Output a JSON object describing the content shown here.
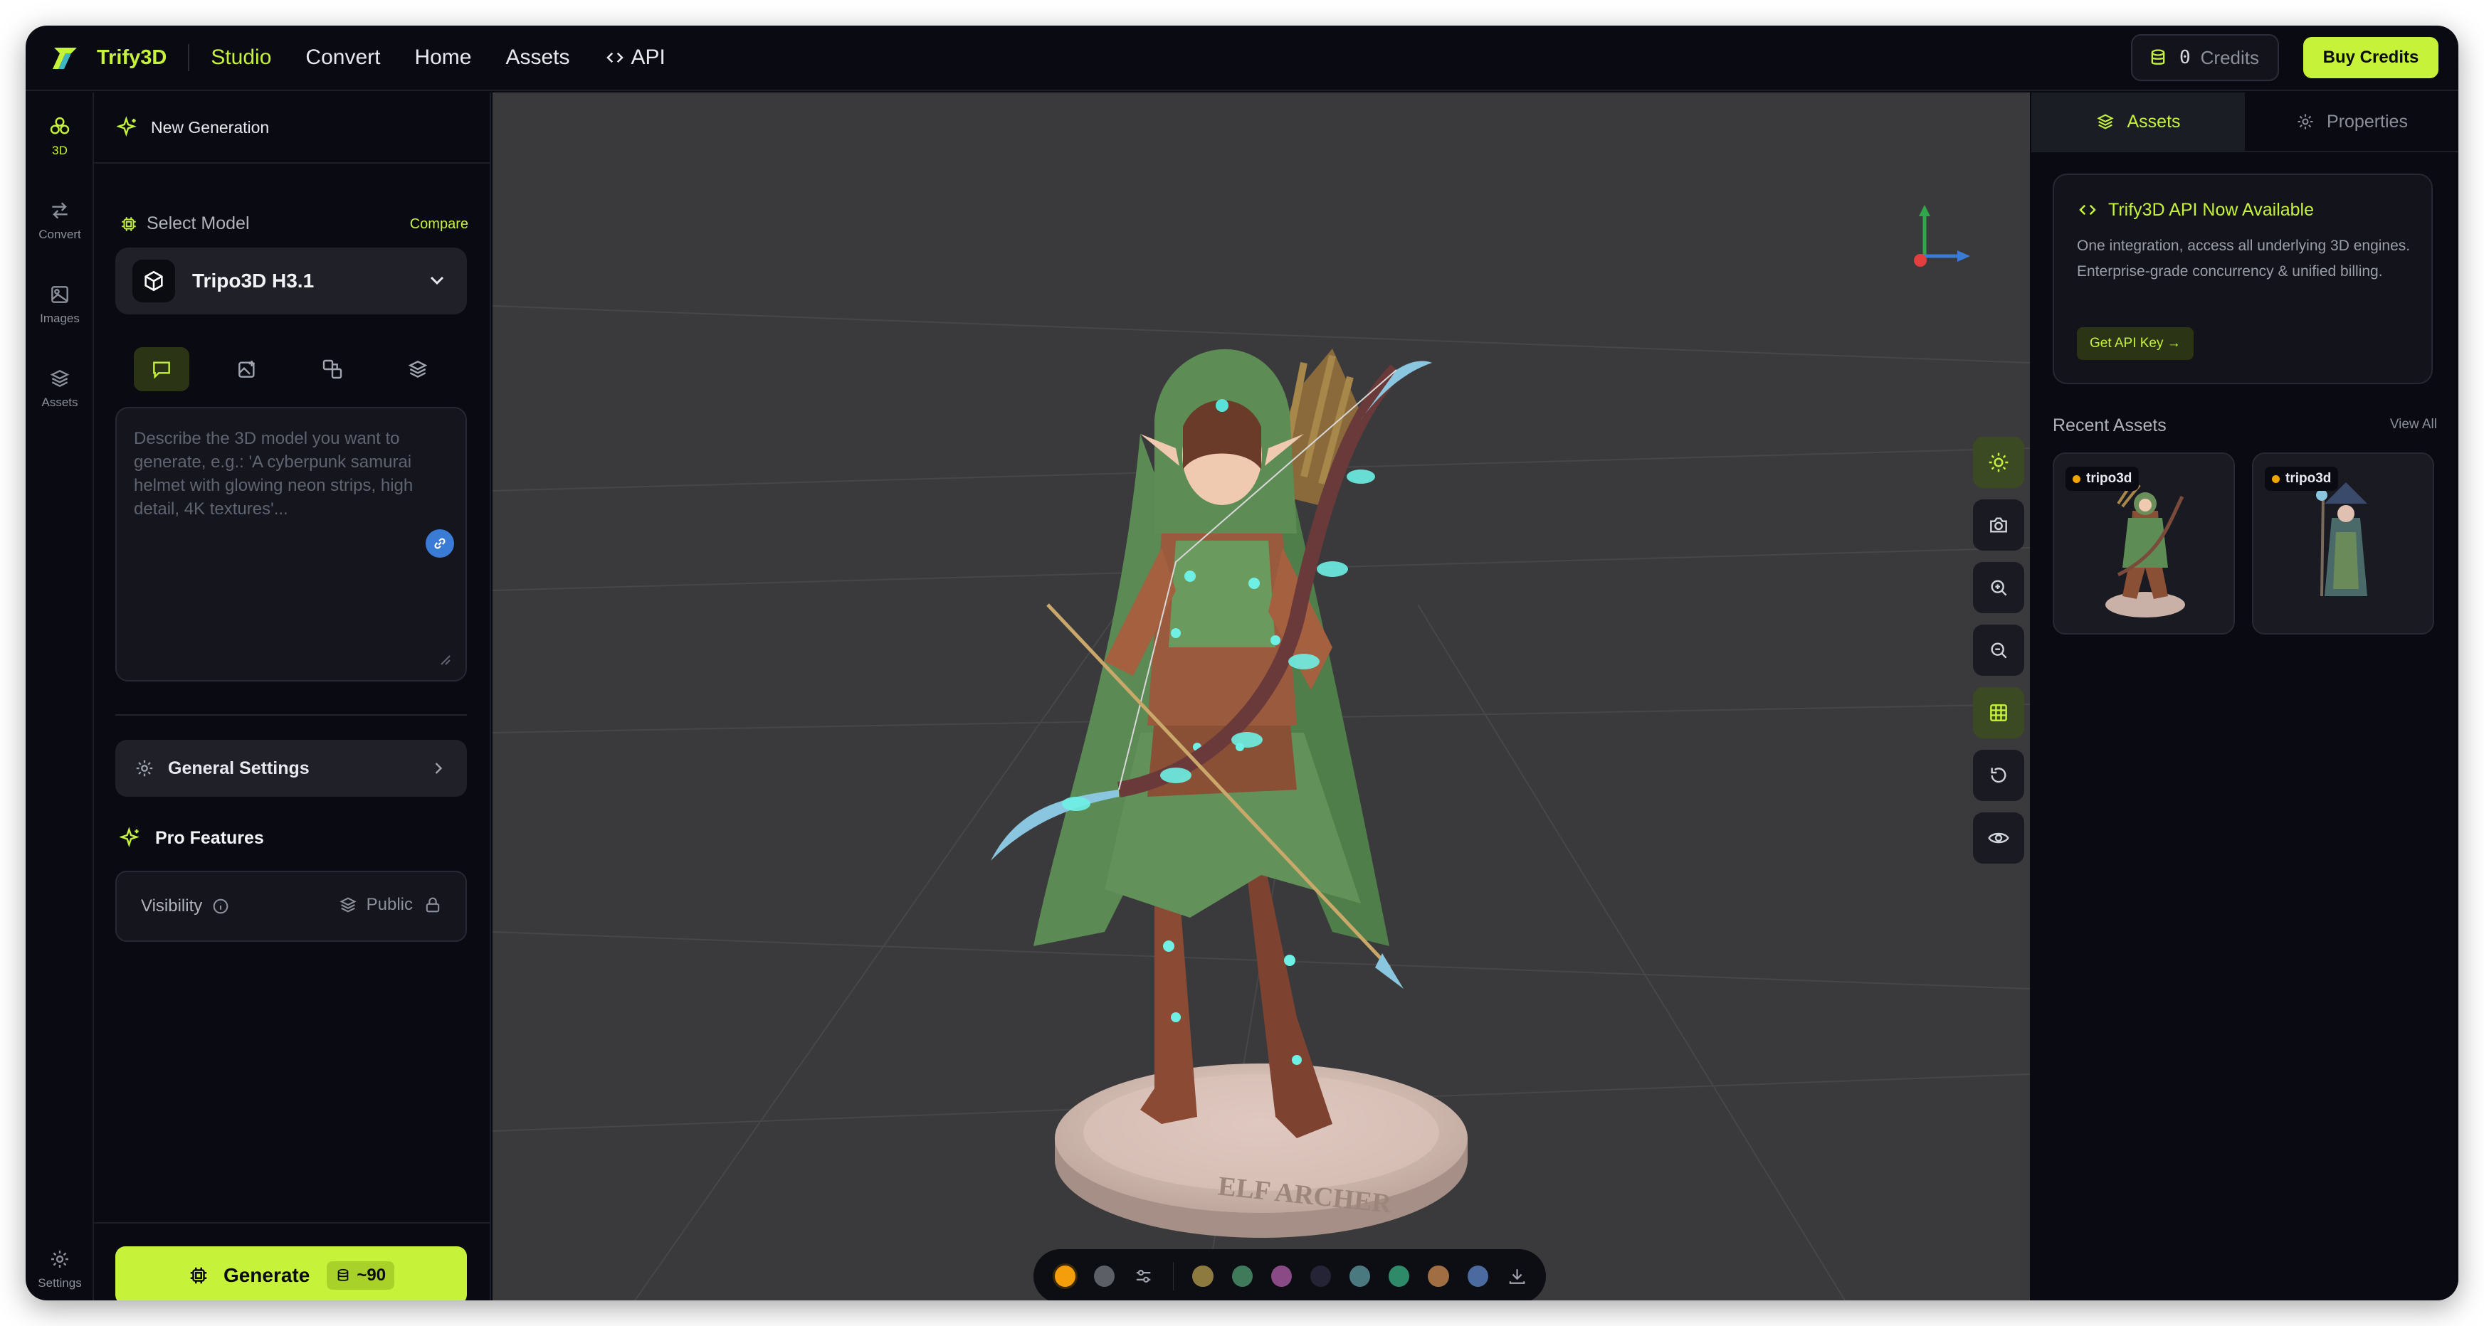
{
  "app": {
    "brand": "Trify3D"
  },
  "nav": {
    "items": [
      "Studio",
      "Convert",
      "Home",
      "Assets",
      "API"
    ],
    "active": "Studio"
  },
  "credits": {
    "count": "0",
    "label": "Credits"
  },
  "buy_label": "Buy Credits",
  "rail": {
    "items": [
      {
        "label": "3D",
        "icon": "cube-cluster-icon",
        "active": true
      },
      {
        "label": "Convert",
        "icon": "swap-arrows-icon"
      },
      {
        "label": "Images",
        "icon": "image-icon"
      },
      {
        "label": "Assets",
        "icon": "layers-icon"
      }
    ],
    "settings_label": "Settings"
  },
  "left": {
    "new_generation": "New Generation",
    "select_model_label": "Select Model",
    "compare": "Compare",
    "model_name": "Tripo3D H3.1",
    "input_modes": [
      "text-prompt-icon",
      "image-upload-icon",
      "multi-image-icon",
      "layers-icon"
    ],
    "prompt_placeholder": "Describe the 3D model you want to generate, e.g.: 'A cyberpunk samurai helmet with glowing neon strips, high detail, 4K textures'...",
    "general_settings": "General Settings",
    "pro_features": "Pro Features",
    "visibility_label": "Visibility",
    "visibility_value": "Public",
    "generate_label": "Generate",
    "generate_cost": "~90"
  },
  "viewport": {
    "model_text": "ELF ARCHER",
    "controls": [
      "light-icon",
      "camera-icon",
      "zoom-in-icon",
      "zoom-out-icon",
      "grid-icon",
      "reset-view-icon",
      "eye-icon"
    ],
    "active_controls": [
      "light-icon",
      "grid-icon"
    ],
    "swatches": [
      "#f59e0b",
      "#5c5f66",
      "#8c7a3e",
      "#3f7a5a",
      "#8a4a86",
      "#242436",
      "#4a7a7f",
      "#2f8a6a",
      "#a06e42",
      "#4a6aa0"
    ]
  },
  "right": {
    "tabs": [
      "Assets",
      "Properties"
    ],
    "active_tab": "Assets",
    "api_card": {
      "title": "Trify3D API Now Available",
      "description": "One integration, access all underlying 3D engines. Enterprise-grade concurrency & unified billing.",
      "button": "Get API Key →"
    },
    "recent_title": "Recent Assets",
    "view_all": "View All",
    "assets": [
      {
        "tag": "tripo3d"
      },
      {
        "tag": "tripo3d"
      }
    ]
  },
  "colors": {
    "accent": "#c6f33a",
    "background": "#0a0b12",
    "viewport": "#3a3a3c"
  }
}
